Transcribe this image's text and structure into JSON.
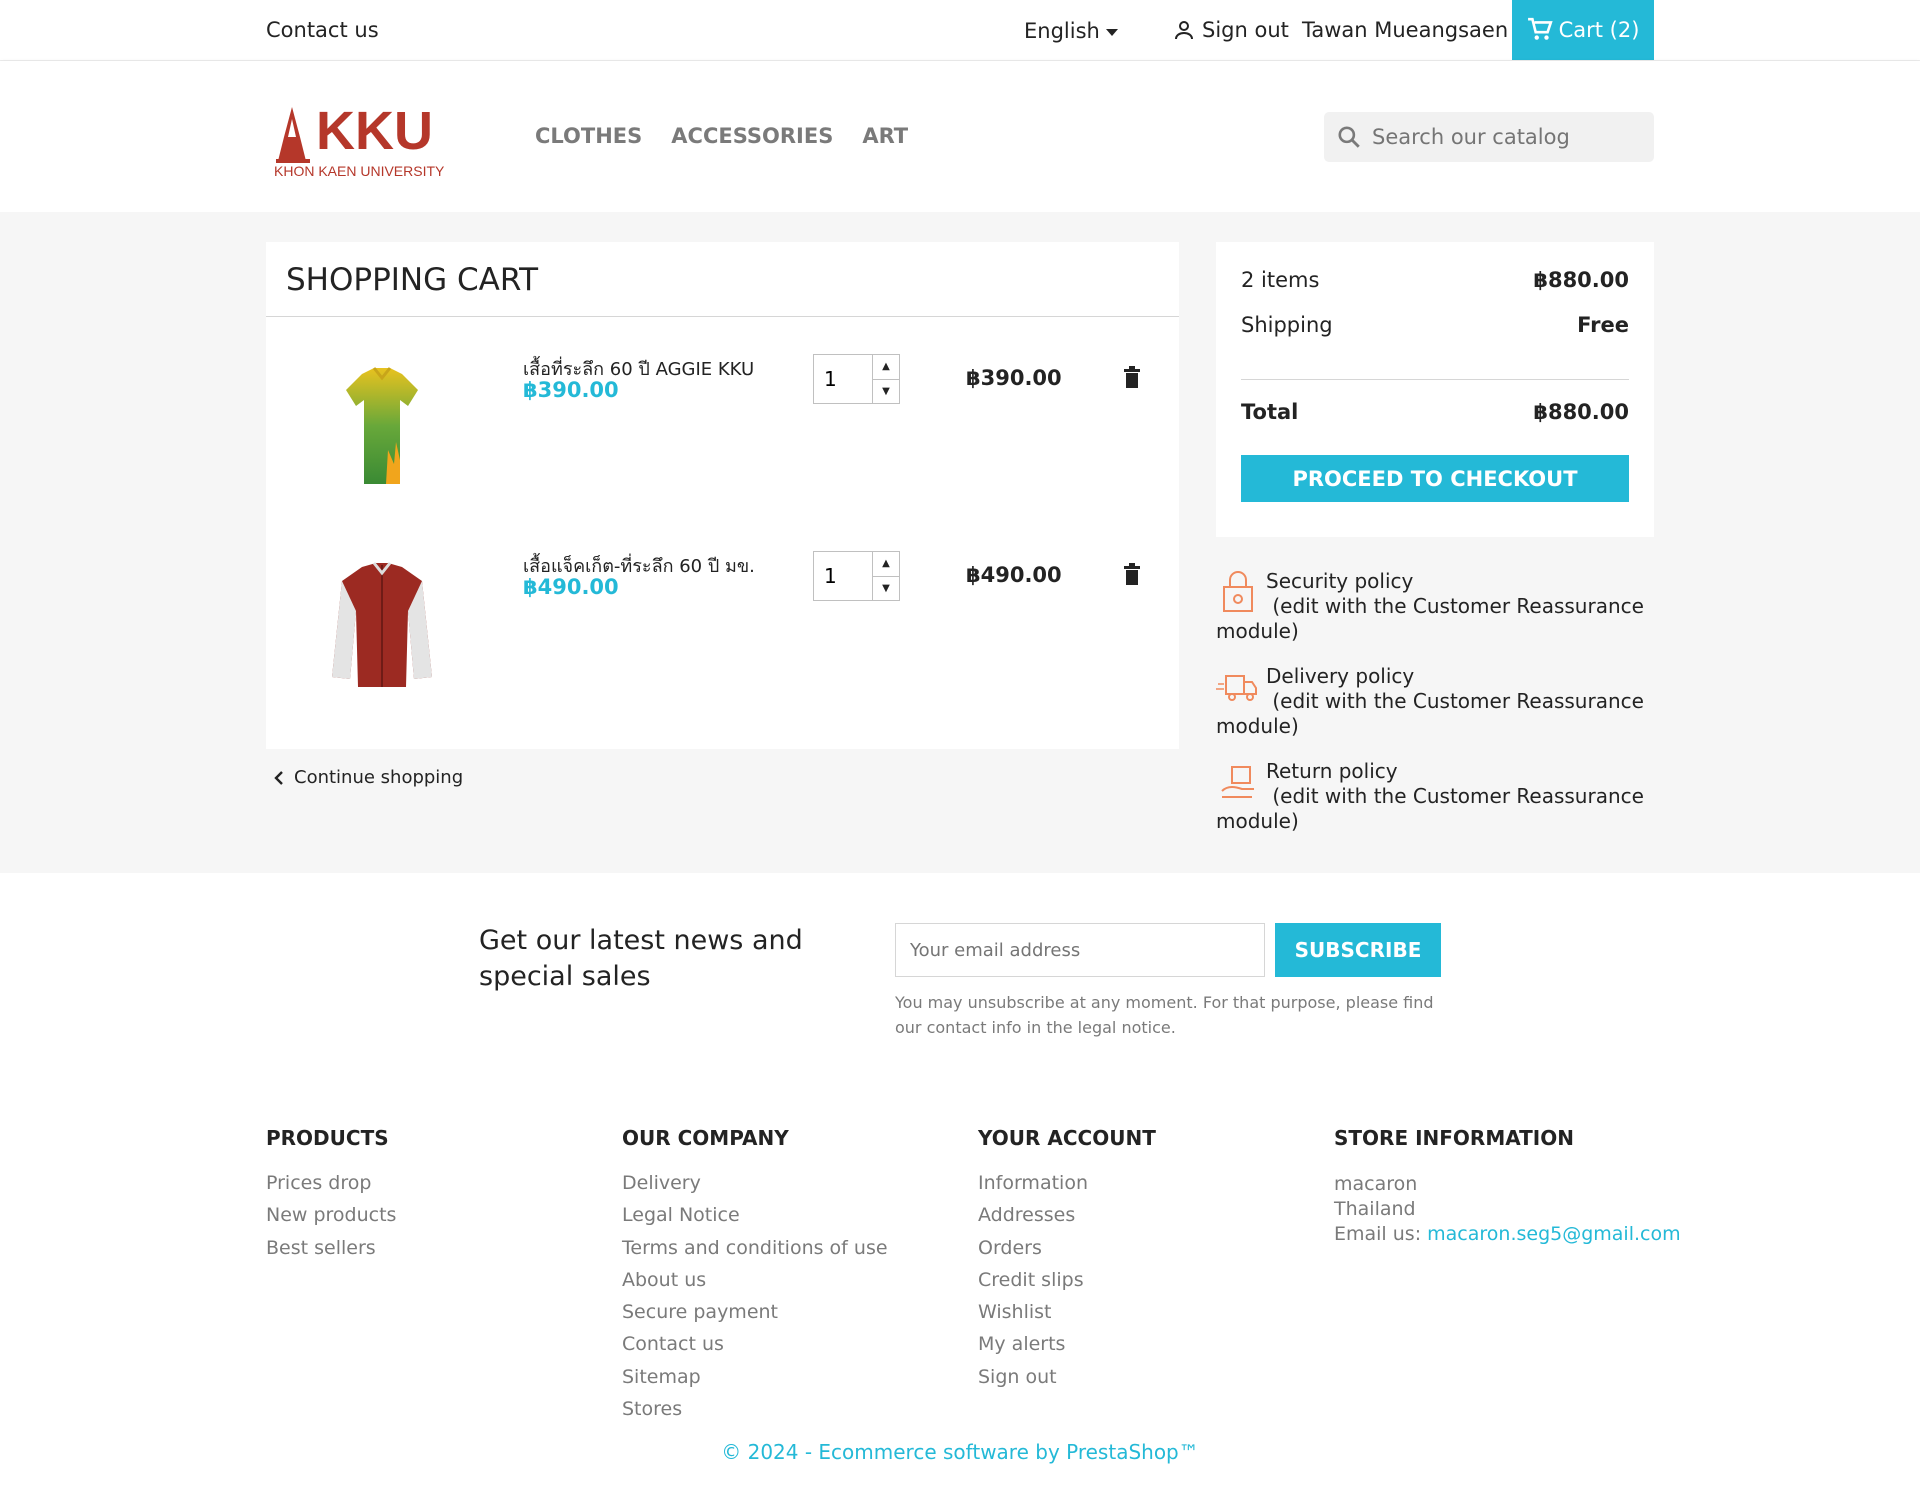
{
  "topbar": {
    "contact": "Contact us",
    "language": "English",
    "signout": "Sign out",
    "username": "Tawan Mueangsaen",
    "cart": "Cart (2)"
  },
  "header": {
    "logo_text": "KKU",
    "logo_sub": "KHON KAEN UNIVERSITY",
    "nav": [
      "CLOTHES",
      "ACCESSORIES",
      "ART"
    ],
    "search_placeholder": "Search our catalog"
  },
  "cart": {
    "title": "SHOPPING CART",
    "items": [
      {
        "name": "เสื้อที่ระลึก 60 ปี AGGIE KKU",
        "price": "฿390.00",
        "qty": "1",
        "total": "฿390.00"
      },
      {
        "name": "เสื้อแจ็คเก็ต-ที่ระลึก 60 ปี มข.",
        "price": "฿490.00",
        "qty": "1",
        "total": "฿490.00"
      }
    ],
    "continue": "Continue shopping"
  },
  "summary": {
    "items_label": "2 items",
    "items_value": "฿880.00",
    "shipping_label": "Shipping",
    "shipping_value": "Free",
    "total_label": "Total",
    "total_value": "฿880.00",
    "checkout": "PROCEED TO CHECKOUT"
  },
  "reassurance": [
    {
      "title": "Security policy",
      "desc": "(edit with the Customer Reassurance module)"
    },
    {
      "title": "Delivery policy",
      "desc": "(edit with the Customer Reassurance module)"
    },
    {
      "title": "Return policy",
      "desc": "(edit with the Customer Reassurance module)"
    }
  ],
  "newsletter": {
    "title": "Get our latest news and special sales",
    "placeholder": "Your email address",
    "button": "SUBSCRIBE",
    "note": "You may unsubscribe at any moment. For that purpose, please find our contact info in the legal notice."
  },
  "footer": {
    "products": {
      "title": "PRODUCTS",
      "links": [
        "Prices drop",
        "New products",
        "Best sellers"
      ]
    },
    "company": {
      "title": "OUR COMPANY",
      "links": [
        "Delivery",
        "Legal Notice",
        "Terms and conditions of use",
        "About us",
        "Secure payment",
        "Contact us",
        "Sitemap",
        "Stores"
      ]
    },
    "account": {
      "title": "YOUR ACCOUNT",
      "links": [
        "Information",
        "Addresses",
        "Orders",
        "Credit slips",
        "Wishlist",
        "My alerts",
        "Sign out"
      ]
    },
    "store": {
      "title": "STORE INFORMATION",
      "name": "macaron",
      "country": "Thailand",
      "email_label": "Email us: ",
      "email": "macaron.seg5@gmail.com"
    },
    "copyright": "© 2024 - Ecommerce software by PrestaShop™"
  },
  "colors": {
    "accent": "#24b9d7",
    "brand": "#b5372a"
  }
}
